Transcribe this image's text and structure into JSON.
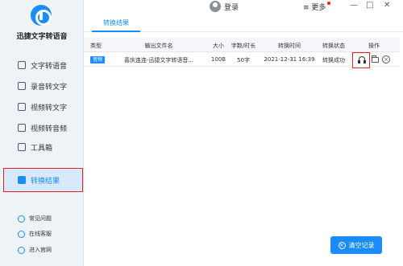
{
  "app": {
    "name": "迅捷文字转语音"
  },
  "sidebar": {
    "items": [
      {
        "label": "文字转语音",
        "icon": "text-to-speech-icon"
      },
      {
        "label": "录音转文字",
        "icon": "recording-icon"
      },
      {
        "label": "视频转文字",
        "icon": "video-text-icon"
      },
      {
        "label": "视频转音频",
        "icon": "video-audio-icon"
      },
      {
        "label": "工具箱",
        "icon": "toolbox-icon"
      }
    ],
    "active": {
      "label": "转换结果",
      "icon": "result-icon"
    },
    "footer": [
      {
        "label": "常见问题",
        "icon": "help-icon"
      },
      {
        "label": "在线客服",
        "icon": "support-icon"
      },
      {
        "label": "进入官网",
        "icon": "website-icon"
      }
    ]
  },
  "topbar": {
    "login": "登录",
    "more": "更多",
    "window_buttons": [
      "≡",
      "—",
      "□",
      "✕"
    ]
  },
  "tabs": [
    {
      "label": "转换结果"
    }
  ],
  "table": {
    "headers": [
      "类型",
      "输出文件名",
      "大小",
      "字数/时长",
      "转换时间",
      "转换状态",
      "操作"
    ],
    "rows": [
      {
        "type_badge": "音频",
        "filename": "喜庆连连-迅捷文字转语音...",
        "size": "100B",
        "duration": "50字",
        "time": "2021-12-31 16:39",
        "status": "转换成功"
      }
    ]
  },
  "clear_button": {
    "label": "清空记录"
  },
  "colors": {
    "accent": "#1a8cff",
    "highlight": "#e02424",
    "sidebar_bg": "#eef3f8"
  }
}
